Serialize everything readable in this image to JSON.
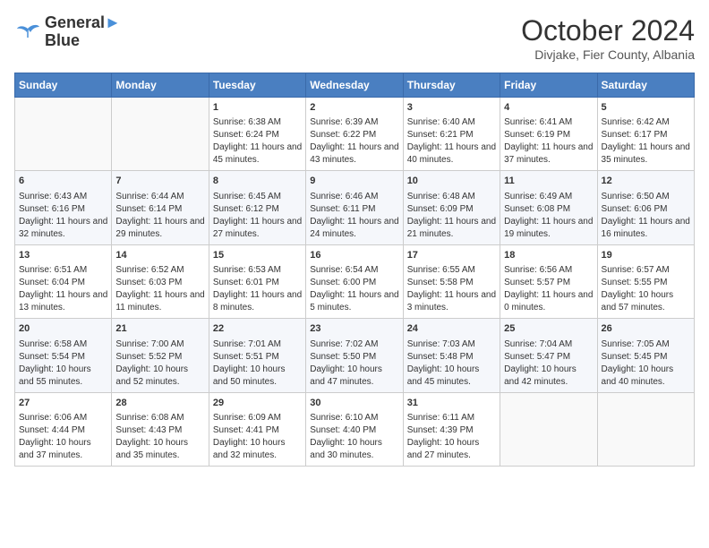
{
  "logo": {
    "line1": "General",
    "line2": "Blue"
  },
  "title": "October 2024",
  "subtitle": "Divjake, Fier County, Albania",
  "days_of_week": [
    "Sunday",
    "Monday",
    "Tuesday",
    "Wednesday",
    "Thursday",
    "Friday",
    "Saturday"
  ],
  "weeks": [
    [
      {
        "day": null,
        "sunrise": null,
        "sunset": null,
        "daylight": null
      },
      {
        "day": null,
        "sunrise": null,
        "sunset": null,
        "daylight": null
      },
      {
        "day": "1",
        "sunrise": "6:38 AM",
        "sunset": "6:24 PM",
        "daylight": "11 hours and 45 minutes."
      },
      {
        "day": "2",
        "sunrise": "6:39 AM",
        "sunset": "6:22 PM",
        "daylight": "11 hours and 43 minutes."
      },
      {
        "day": "3",
        "sunrise": "6:40 AM",
        "sunset": "6:21 PM",
        "daylight": "11 hours and 40 minutes."
      },
      {
        "day": "4",
        "sunrise": "6:41 AM",
        "sunset": "6:19 PM",
        "daylight": "11 hours and 37 minutes."
      },
      {
        "day": "5",
        "sunrise": "6:42 AM",
        "sunset": "6:17 PM",
        "daylight": "11 hours and 35 minutes."
      }
    ],
    [
      {
        "day": "6",
        "sunrise": "6:43 AM",
        "sunset": "6:16 PM",
        "daylight": "11 hours and 32 minutes."
      },
      {
        "day": "7",
        "sunrise": "6:44 AM",
        "sunset": "6:14 PM",
        "daylight": "11 hours and 29 minutes."
      },
      {
        "day": "8",
        "sunrise": "6:45 AM",
        "sunset": "6:12 PM",
        "daylight": "11 hours and 27 minutes."
      },
      {
        "day": "9",
        "sunrise": "6:46 AM",
        "sunset": "6:11 PM",
        "daylight": "11 hours and 24 minutes."
      },
      {
        "day": "10",
        "sunrise": "6:48 AM",
        "sunset": "6:09 PM",
        "daylight": "11 hours and 21 minutes."
      },
      {
        "day": "11",
        "sunrise": "6:49 AM",
        "sunset": "6:08 PM",
        "daylight": "11 hours and 19 minutes."
      },
      {
        "day": "12",
        "sunrise": "6:50 AM",
        "sunset": "6:06 PM",
        "daylight": "11 hours and 16 minutes."
      }
    ],
    [
      {
        "day": "13",
        "sunrise": "6:51 AM",
        "sunset": "6:04 PM",
        "daylight": "11 hours and 13 minutes."
      },
      {
        "day": "14",
        "sunrise": "6:52 AM",
        "sunset": "6:03 PM",
        "daylight": "11 hours and 11 minutes."
      },
      {
        "day": "15",
        "sunrise": "6:53 AM",
        "sunset": "6:01 PM",
        "daylight": "11 hours and 8 minutes."
      },
      {
        "day": "16",
        "sunrise": "6:54 AM",
        "sunset": "6:00 PM",
        "daylight": "11 hours and 5 minutes."
      },
      {
        "day": "17",
        "sunrise": "6:55 AM",
        "sunset": "5:58 PM",
        "daylight": "11 hours and 3 minutes."
      },
      {
        "day": "18",
        "sunrise": "6:56 AM",
        "sunset": "5:57 PM",
        "daylight": "11 hours and 0 minutes."
      },
      {
        "day": "19",
        "sunrise": "6:57 AM",
        "sunset": "5:55 PM",
        "daylight": "10 hours and 57 minutes."
      }
    ],
    [
      {
        "day": "20",
        "sunrise": "6:58 AM",
        "sunset": "5:54 PM",
        "daylight": "10 hours and 55 minutes."
      },
      {
        "day": "21",
        "sunrise": "7:00 AM",
        "sunset": "5:52 PM",
        "daylight": "10 hours and 52 minutes."
      },
      {
        "day": "22",
        "sunrise": "7:01 AM",
        "sunset": "5:51 PM",
        "daylight": "10 hours and 50 minutes."
      },
      {
        "day": "23",
        "sunrise": "7:02 AM",
        "sunset": "5:50 PM",
        "daylight": "10 hours and 47 minutes."
      },
      {
        "day": "24",
        "sunrise": "7:03 AM",
        "sunset": "5:48 PM",
        "daylight": "10 hours and 45 minutes."
      },
      {
        "day": "25",
        "sunrise": "7:04 AM",
        "sunset": "5:47 PM",
        "daylight": "10 hours and 42 minutes."
      },
      {
        "day": "26",
        "sunrise": "7:05 AM",
        "sunset": "5:45 PM",
        "daylight": "10 hours and 40 minutes."
      }
    ],
    [
      {
        "day": "27",
        "sunrise": "6:06 AM",
        "sunset": "4:44 PM",
        "daylight": "10 hours and 37 minutes."
      },
      {
        "day": "28",
        "sunrise": "6:08 AM",
        "sunset": "4:43 PM",
        "daylight": "10 hours and 35 minutes."
      },
      {
        "day": "29",
        "sunrise": "6:09 AM",
        "sunset": "4:41 PM",
        "daylight": "10 hours and 32 minutes."
      },
      {
        "day": "30",
        "sunrise": "6:10 AM",
        "sunset": "4:40 PM",
        "daylight": "10 hours and 30 minutes."
      },
      {
        "day": "31",
        "sunrise": "6:11 AM",
        "sunset": "4:39 PM",
        "daylight": "10 hours and 27 minutes."
      },
      {
        "day": null,
        "sunrise": null,
        "sunset": null,
        "daylight": null
      },
      {
        "day": null,
        "sunrise": null,
        "sunset": null,
        "daylight": null
      }
    ]
  ]
}
